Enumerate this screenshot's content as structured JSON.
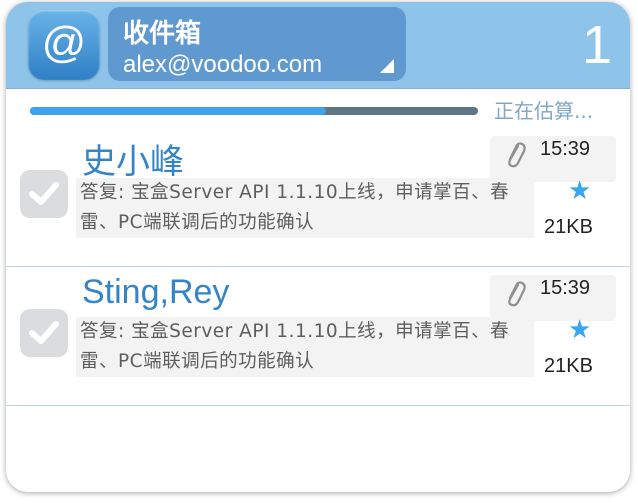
{
  "header": {
    "folder_name": "收件箱",
    "account_email": "alex@voodoo.com",
    "unread_count": "1",
    "app_icon_glyph": "@"
  },
  "sync": {
    "status_text": "正在估算...",
    "progress_fraction": 0.66
  },
  "messages": [
    {
      "sender": "史小峰",
      "subject": "答复: 宝盒Server API 1.1.10上线，申请掌百、春雷、PC端联调后的功能确认",
      "time": "15:39",
      "size": "21KB",
      "starred": true,
      "has_attachment": true,
      "checked": false
    },
    {
      "sender": "Sting,Rey",
      "subject": "答复: 宝盒Server API 1.1.10上线，申请掌百、春雷、PC端联调后的功能确认",
      "time": "15:39",
      "size": "21KB",
      "starred": true,
      "has_attachment": true,
      "checked": false
    }
  ],
  "icons": {
    "star": "★",
    "attachment": "paperclip-icon",
    "checkbox": "checkmark-icon",
    "dropdown": "dropdown-triangle-icon"
  },
  "colors": {
    "header_bg": "#8ec4ea",
    "account_bg": "#5f99cf",
    "accent_blue": "#3584c7",
    "progress_fill": "#3fa2ea",
    "progress_track": "#5e7585",
    "star": "#39a6ee"
  }
}
